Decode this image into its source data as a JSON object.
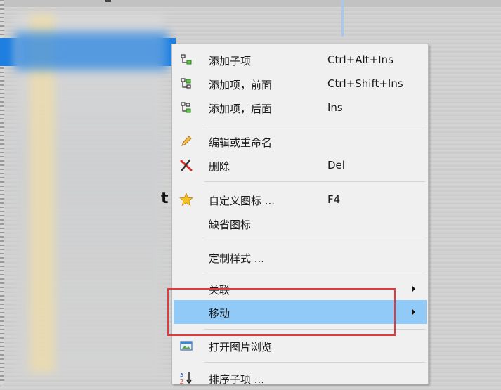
{
  "colors": {
    "menu_bg": "#f0f0f0",
    "highlight": "#91c9f7",
    "selection_blue": "#1e7fe0",
    "annotation_red": "#e03a40"
  },
  "background": {
    "partial_text": "t"
  },
  "context_menu": {
    "items": [
      {
        "label": "添加子项",
        "shortcut": "Ctrl+Alt+Ins",
        "icon": "add-child-icon"
      },
      {
        "label": "添加项，前面",
        "shortcut": "Ctrl+Shift+Ins",
        "icon": "add-before-icon"
      },
      {
        "label": "添加项，后面",
        "shortcut": "Ins",
        "icon": "add-after-icon"
      },
      {
        "label": "编辑或重命名",
        "shortcut": "",
        "icon": "pencil-icon"
      },
      {
        "label": "删除",
        "shortcut": "Del",
        "icon": "delete-x-icon"
      },
      {
        "label": "自定义图标 ...",
        "shortcut": "F4",
        "icon": "star-icon"
      },
      {
        "label": "缺省图标",
        "shortcut": "",
        "icon": ""
      },
      {
        "label": "定制样式 ...",
        "shortcut": "",
        "icon": ""
      },
      {
        "label": "关联",
        "shortcut": "",
        "icon": "",
        "submenu": true
      },
      {
        "label": "移动",
        "shortcut": "",
        "icon": "",
        "submenu": true,
        "highlighted": true
      },
      {
        "label": "打开图片浏览",
        "shortcut": "",
        "icon": "image-viewer-icon"
      },
      {
        "label": "排序子项 ...",
        "shortcut": "",
        "icon": "sort-az-icon"
      }
    ]
  }
}
